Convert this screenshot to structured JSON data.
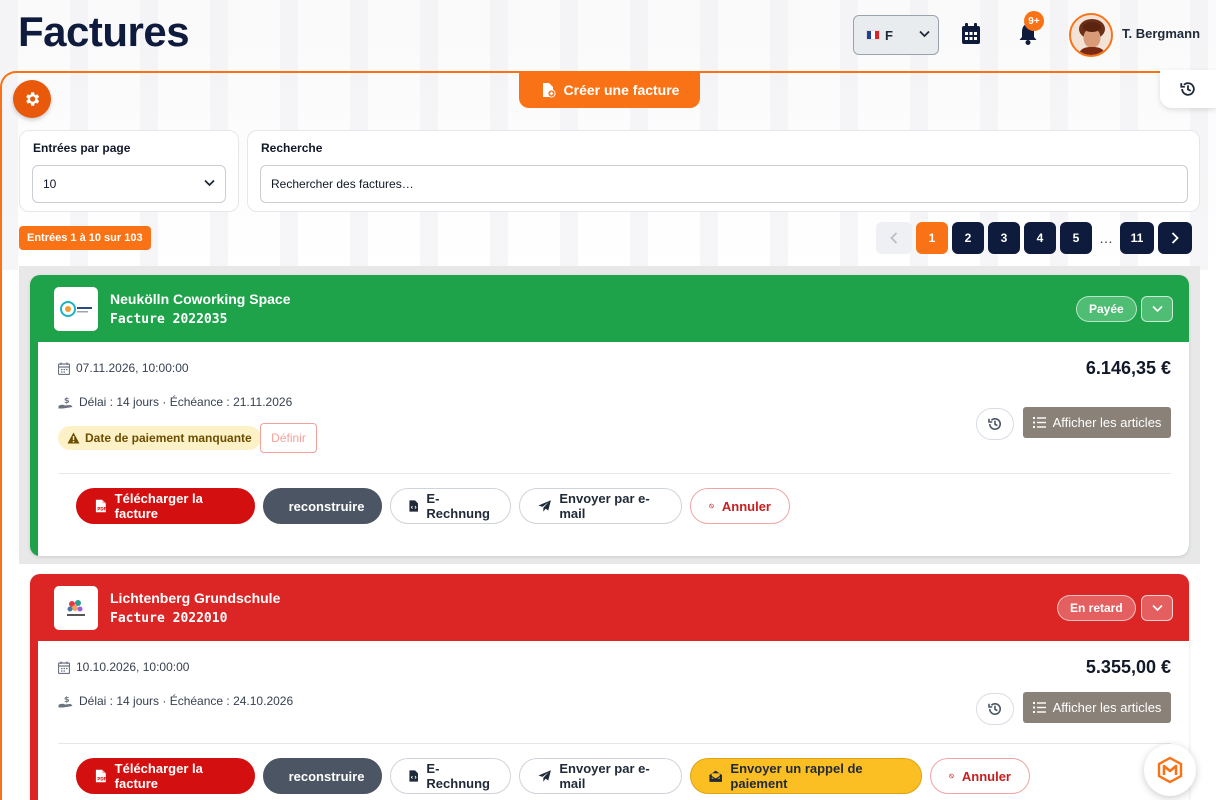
{
  "header": {
    "title": "Factures",
    "language": {
      "code": "F",
      "flag": "fr"
    },
    "notifications_badge": "9+",
    "user_name": "T. Bergmann"
  },
  "toolbar": {
    "create_invoice_label": "Créer une facture"
  },
  "filters": {
    "entries_label": "Entrées par page",
    "entries_value": "10",
    "search_label": "Recherche",
    "search_placeholder": "Rechercher des factures…"
  },
  "listing": {
    "summary": "Entrées 1 à 10 sur 103",
    "pages": [
      "1",
      "2",
      "3",
      "4",
      "5",
      "…",
      "11"
    ],
    "current_page": "1"
  },
  "invoices": [
    {
      "client": "Neukölln Coworking Space",
      "number": "Facture 2022035",
      "status": "Payée",
      "status_color": "#1ea34a",
      "date": "07.11.2026, 10:00:00",
      "terms": "Délai : 14 jours · Échéance : 21.11.2026",
      "warning": "Date de paiement manquante",
      "define_label": "Définir",
      "amount": "6.146,35 €",
      "articles_label": "Afficher les articles",
      "actions": {
        "pdf": "Télécharger la facture",
        "rebuild": "reconstruire",
        "erechnung": "E-Rechnung",
        "email": "Envoyer par e-mail",
        "cancel": "Annuler"
      }
    },
    {
      "client": "Lichtenberg Grundschule",
      "number": "Facture 2022010",
      "status": "En retard",
      "status_color": "#dc2626",
      "date": "10.10.2026, 10:00:00",
      "terms": "Délai : 14 jours · Échéance : 24.10.2026",
      "amount": "5.355,00 €",
      "articles_label": "Afficher les articles",
      "actions": {
        "pdf": "Télécharger la facture",
        "rebuild": "reconstruire",
        "erechnung": "E-Rechnung",
        "email": "Envoyer par e-mail",
        "reminder": "Envoyer un rappel de paiement",
        "cancel": "Annuler"
      }
    }
  ],
  "colors": {
    "accent": "#f97316",
    "navy": "#0f1b3d"
  }
}
